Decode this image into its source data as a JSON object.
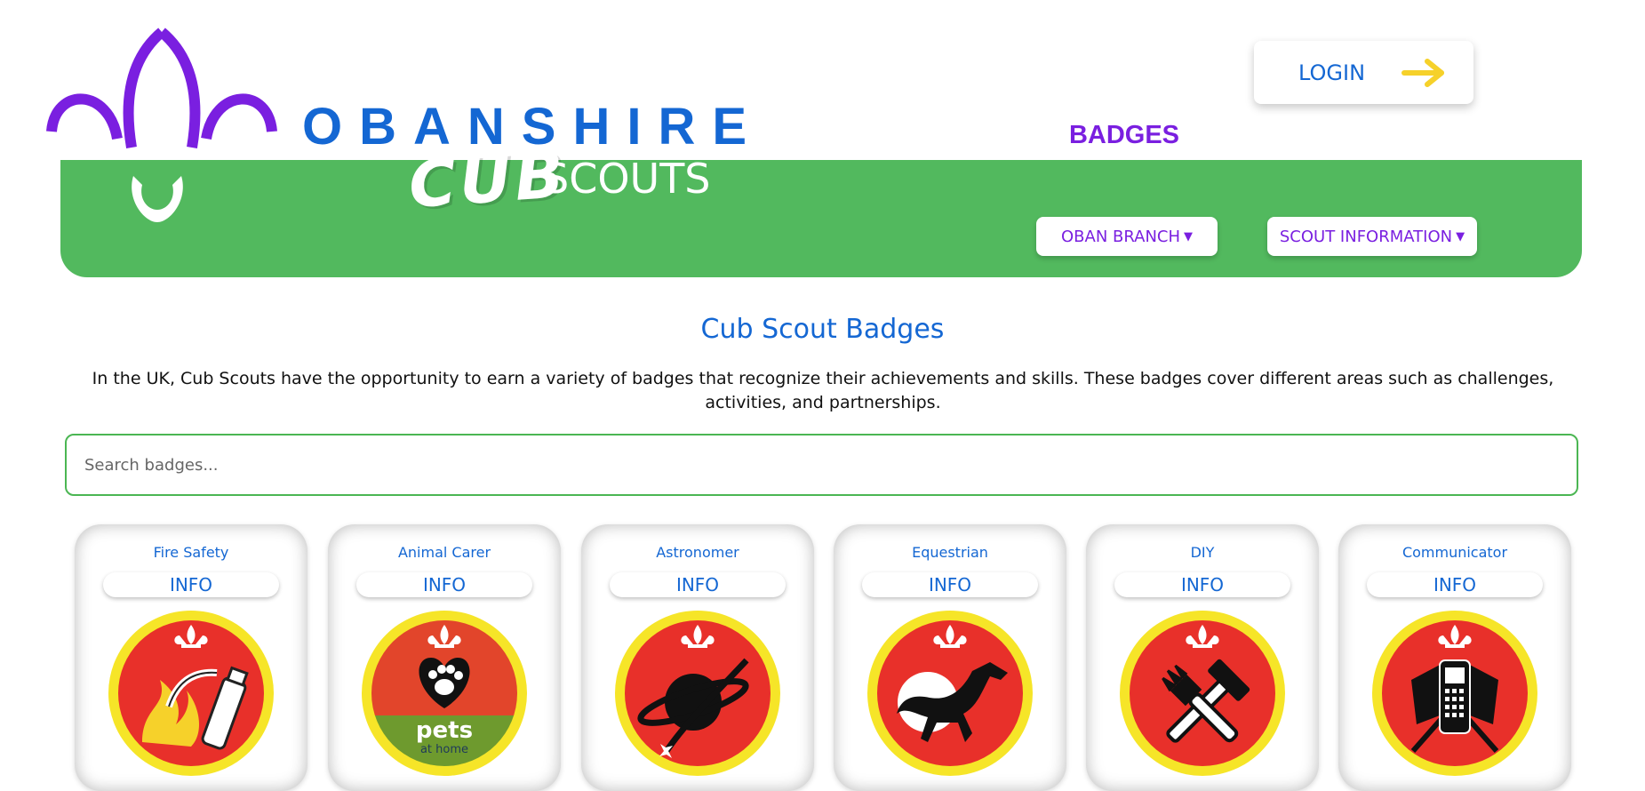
{
  "header": {
    "brand_name": "OBANSHIRE",
    "login_label": "LOGIN",
    "page_heading": "BADGES",
    "banner_cub": "CUB",
    "banner_scouts": "SCOUTS",
    "nav": [
      {
        "label": "OBAN BRANCH"
      },
      {
        "label": "SCOUT INFORMATION"
      }
    ]
  },
  "main": {
    "title": "Cub Scout Badges",
    "intro": "In the UK, Cub Scouts have the opportunity to earn a variety of badges that recognize their achievements and skills. These badges cover different areas such as challenges, activities, and partnerships.",
    "search_placeholder": "Search badges...",
    "info_label": "INFO",
    "badges": [
      {
        "name": "Fire Safety",
        "icon": "fire-extinguisher-icon"
      },
      {
        "name": "Animal Carer",
        "icon": "paw-heart-icon",
        "partner_main": "pets",
        "partner_sub": "at home"
      },
      {
        "name": "Astronomer",
        "icon": "planet-icon"
      },
      {
        "name": "Equestrian",
        "icon": "horse-icon"
      },
      {
        "name": "DIY",
        "icon": "hammer-brush-icon"
      },
      {
        "name": "Communicator",
        "icon": "phone-flags-icon"
      }
    ]
  },
  "colors": {
    "brand_blue": "#1467d3",
    "purple": "#7a1fe0",
    "banner_green": "#52b95e",
    "badge_red": "#e8302a",
    "badge_yellow": "#f6e528"
  }
}
